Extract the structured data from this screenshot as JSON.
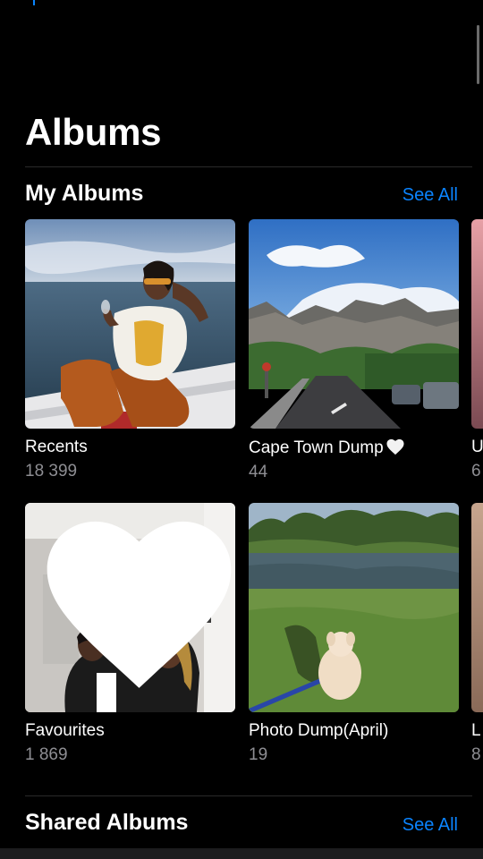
{
  "page": {
    "title": "Albums"
  },
  "my_albums": {
    "title": "My Albums",
    "see_all": "See All",
    "albums": [
      {
        "name": "Recents",
        "count": "18 399"
      },
      {
        "name": "Cape Town Dump",
        "count": "44",
        "name_icon": "heart-icon"
      },
      {
        "name": "Favourites",
        "count": "1 869",
        "badge_icon": "heart-icon"
      },
      {
        "name": "Photo Dump(April)",
        "count": "19"
      }
    ],
    "peek": [
      {
        "name": "U",
        "count": "6"
      },
      {
        "name": "L",
        "count": "8"
      }
    ]
  },
  "shared_albums": {
    "title": "Shared Albums",
    "see_all": "See All"
  },
  "colors": {
    "accent": "#0a84ff",
    "background": "#000000",
    "secondary_text": "#8e8e93"
  }
}
